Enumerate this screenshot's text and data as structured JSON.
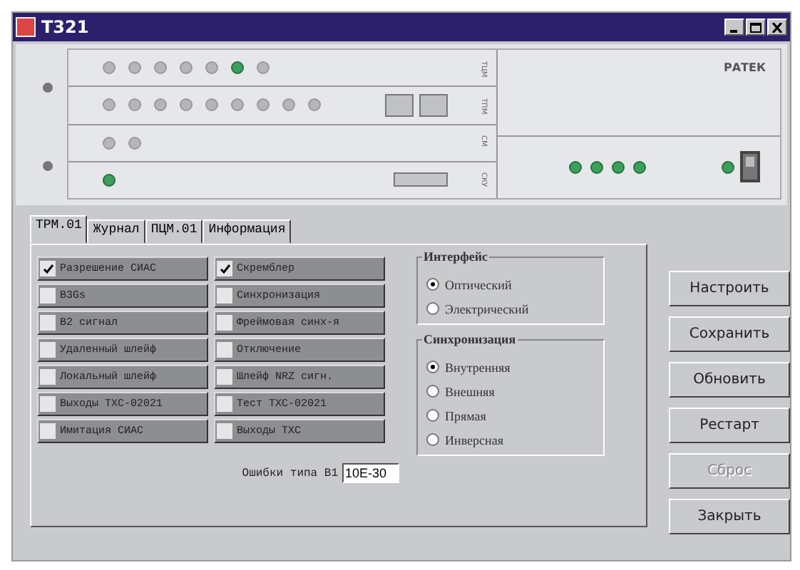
{
  "window": {
    "title": "T321"
  },
  "device": {
    "logo": "РАТЕК",
    "modules": [
      {
        "label": "ТЦМ",
        "leds": [
          {
            "on": false
          },
          {
            "on": false
          },
          {
            "on": false
          },
          {
            "on": false
          },
          {
            "on": false
          },
          {
            "on": true
          },
          {
            "on": false
          }
        ]
      },
      {
        "label": "ТПМ",
        "leds": [
          {
            "on": false
          },
          {
            "on": false
          },
          {
            "on": false
          },
          {
            "on": false
          },
          {
            "on": false
          },
          {
            "on": false
          },
          {
            "on": false
          },
          {
            "on": false
          },
          {
            "on": false
          }
        ],
        "connectors": [
          {
            "kind": "port"
          },
          {
            "kind": "port"
          }
        ]
      },
      {
        "label": "СМ",
        "leds": [
          {
            "on": false
          },
          {
            "on": false
          }
        ]
      },
      {
        "label": "СКУ",
        "leds": [
          {
            "on": true
          }
        ],
        "connectors": [
          {
            "kind": "plug"
          }
        ]
      }
    ],
    "power_leds": [
      {
        "on": true
      },
      {
        "on": true
      },
      {
        "on": true
      },
      {
        "on": true
      }
    ],
    "switch_led": {
      "on": true
    },
    "power_switch": {
      "on": true
    }
  },
  "tabs": [
    {
      "label": "ТРМ.01",
      "selected": true
    },
    {
      "label": "Журнал",
      "selected": false
    },
    {
      "label": "ПЦМ.01",
      "selected": false
    },
    {
      "label": "Информация",
      "selected": false
    }
  ],
  "options": [
    {
      "label": "Разрешение СИАС",
      "checked": true
    },
    {
      "label": "B3Gs",
      "checked": false
    },
    {
      "label": "B2 сигнал",
      "checked": false
    },
    {
      "label": "Удаленный шлейф",
      "checked": false
    },
    {
      "label": "Локальный шлейф",
      "checked": false
    },
    {
      "label": "Выходы ТХС-02021",
      "checked": false
    },
    {
      "label": "Имитация СИАС",
      "checked": false
    },
    {
      "label": "Скремблер",
      "checked": true
    },
    {
      "label": "Синхронизация",
      "checked": false
    },
    {
      "label": "Фреймовая синх-я",
      "checked": false
    },
    {
      "label": "Отключение",
      "checked": false
    },
    {
      "label": "Шлейф NRZ сигн.",
      "checked": false
    },
    {
      "label": "Тест ТХС-02021",
      "checked": false
    },
    {
      "label": "Выходы ТХС",
      "checked": false
    }
  ],
  "error_field": {
    "label": "Ошибки типа B1",
    "value": "10E-30"
  },
  "groups": [
    {
      "title": "Интерфейс",
      "options": [
        {
          "label": "Оптический",
          "selected": true
        },
        {
          "label": "Электрический",
          "selected": false
        }
      ]
    },
    {
      "title": "Синхронизация",
      "options": [
        {
          "label": "Внутренняя",
          "selected": true
        },
        {
          "label": "Внешняя",
          "selected": false
        },
        {
          "label": "Прямая",
          "selected": false
        },
        {
          "label": "Инверсная",
          "selected": false
        }
      ]
    }
  ],
  "buttons": [
    {
      "label": "Настроить",
      "disabled": false
    },
    {
      "label": "Сохранить",
      "disabled": false
    },
    {
      "label": "Обновить",
      "disabled": false
    },
    {
      "label": "Рестарт",
      "disabled": false
    },
    {
      "label": "Сброс",
      "disabled": true
    },
    {
      "label": "Закрыть",
      "disabled": false
    }
  ]
}
